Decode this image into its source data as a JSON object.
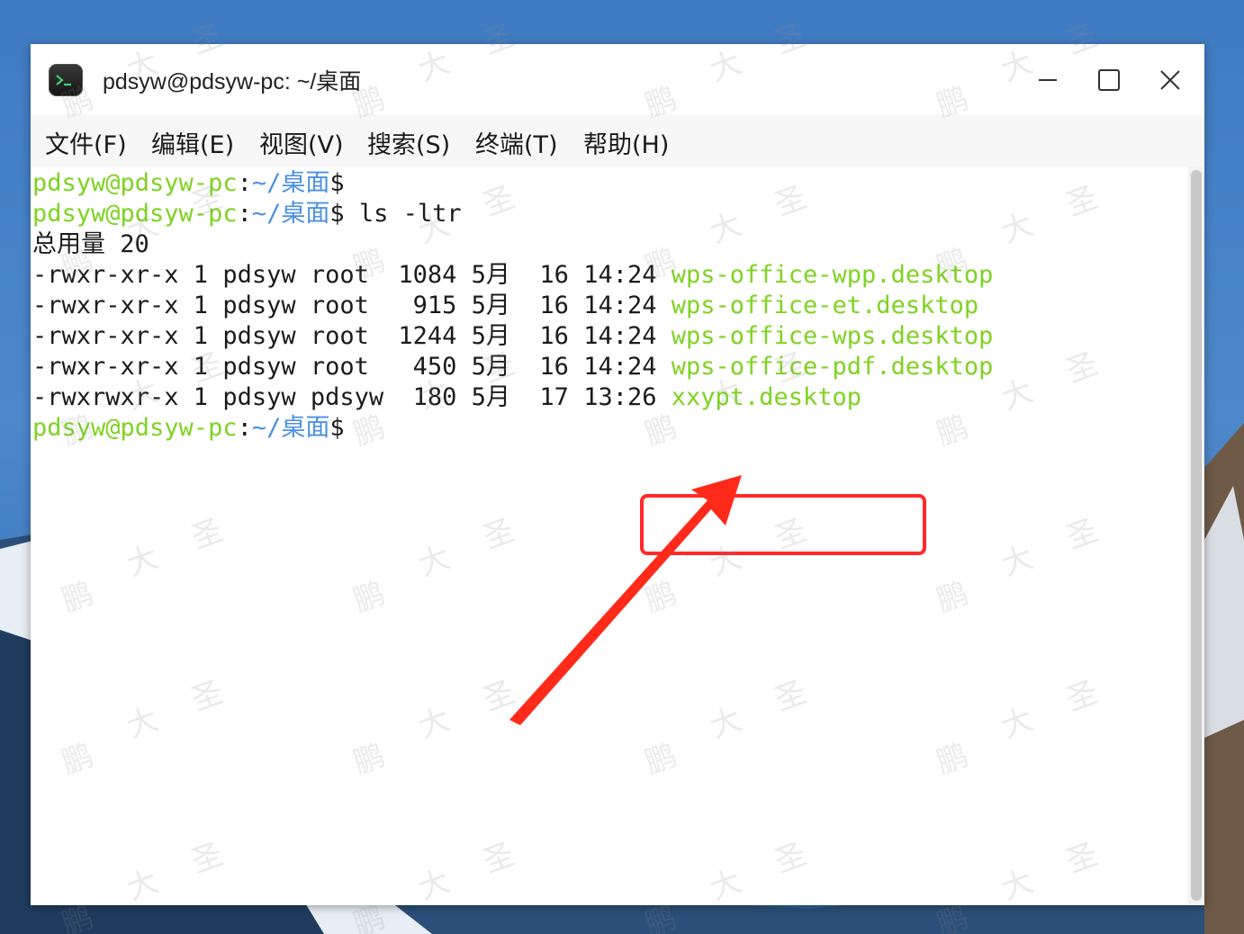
{
  "window": {
    "title": "pdsyw@pdsyw-pc: ~/桌面",
    "icon": "terminal-icon",
    "controls": [
      "minimize-icon",
      "maximize-icon",
      "close-icon"
    ]
  },
  "menu": [
    {
      "label": "文件(F)"
    },
    {
      "label": "编辑(E)"
    },
    {
      "label": "视图(V)"
    },
    {
      "label": "搜索(S)"
    },
    {
      "label": "终端(T)"
    },
    {
      "label": "帮助(H)"
    }
  ],
  "terminal": {
    "prompt_user": "pdsyw@pdsyw-pc",
    "prompt_sep": ":",
    "prompt_path": "~/桌面",
    "prompt_dollar": "$",
    "command": " ls -ltr",
    "total": "总用量 20",
    "rows": [
      {
        "perm": "-rwxr-xr-x",
        "links": "1",
        "owner": "pdsyw",
        "group": "root ",
        "size": "1084",
        "month": "5月",
        "day": "16",
        "time": "14:24",
        "name": "wps-office-wpp.desktop"
      },
      {
        "perm": "-rwxr-xr-x",
        "links": "1",
        "owner": "pdsyw",
        "group": "root ",
        "size": " 915",
        "month": "5月",
        "day": "16",
        "time": "14:24",
        "name": "wps-office-et.desktop"
      },
      {
        "perm": "-rwxr-xr-x",
        "links": "1",
        "owner": "pdsyw",
        "group": "root ",
        "size": "1244",
        "month": "5月",
        "day": "16",
        "time": "14:24",
        "name": "wps-office-wps.desktop"
      },
      {
        "perm": "-rwxr-xr-x",
        "links": "1",
        "owner": "pdsyw",
        "group": "root ",
        "size": " 450",
        "month": "5月",
        "day": "16",
        "time": "14:24",
        "name": "wps-office-pdf.desktop"
      },
      {
        "perm": "-rwxrwxr-x",
        "links": "1",
        "owner": "pdsyw",
        "group": "pdsyw",
        "size": " 180",
        "month": "5月",
        "day": "17",
        "time": "13:26",
        "name": "xxypt.desktop"
      }
    ]
  },
  "annotation": {
    "highlight_color": "#ff2a2a",
    "arrow_color": "#ff2a1a"
  },
  "watermark": {
    "text": [
      "鹏",
      "大",
      "圣"
    ]
  }
}
